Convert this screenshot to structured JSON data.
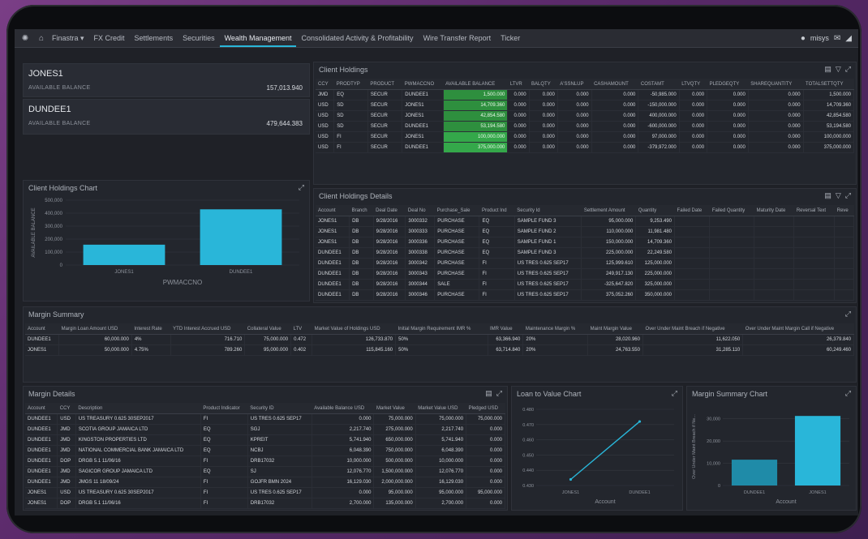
{
  "topbar": {
    "tabs": [
      "Finastra ▾",
      "FX Credit",
      "Settlements",
      "Securities",
      "Wealth Management",
      "Consolidated Activity & Profitability",
      "Wire Transfer Report",
      "Ticker"
    ],
    "active_tab_index": 4,
    "user": "misys"
  },
  "accounts": [
    {
      "name": "JONES1",
      "label": "AVAILABLE BALANCE",
      "value": "157,013.940"
    },
    {
      "name": "DUNDEE1",
      "label": "AVAILABLE BALANCE",
      "value": "479,644.383"
    }
  ],
  "client_holdings": {
    "title": "Client Holdings",
    "columns": [
      "CCY",
      "PRODTYP",
      "PRODUCT",
      "PWMACCNO",
      "AVAILABLE BALANCE",
      "LTVR",
      "BALQTY",
      "A'SSNLUP",
      "CASHAMOUNT",
      "COSTAMT",
      "LTVQTY",
      "PLEDGEQTY",
      "SHAREQUANTITY",
      "TOTALSETTQTY"
    ],
    "rows": [
      [
        "JMD",
        "EQ",
        "SECUR",
        "DUNDEE1",
        "1,500.000",
        "0.000",
        "0.000",
        "0.000",
        "0.000",
        "-50,985.000",
        "0.000",
        "0.000",
        "0.000",
        "1,500.000"
      ],
      [
        "USD",
        "SD",
        "SECUR",
        "JONES1",
        "14,709.360",
        "0.000",
        "0.000",
        "0.000",
        "0.000",
        "-150,000.000",
        "0.000",
        "0.000",
        "0.000",
        "14,709.360"
      ],
      [
        "USD",
        "SD",
        "SECUR",
        "JONES1",
        "42,854.580",
        "0.000",
        "0.000",
        "0.000",
        "0.000",
        "400,000.000",
        "0.000",
        "0.000",
        "0.000",
        "42,854.580"
      ],
      [
        "USD",
        "SD",
        "SECUR",
        "DUNDEE1",
        "53,194.580",
        "0.000",
        "0.000",
        "0.000",
        "0.000",
        "-600,000.000",
        "0.000",
        "0.000",
        "0.000",
        "53,194.580"
      ],
      [
        "USD",
        "FI",
        "SECUR",
        "JONES1",
        "100,000.000",
        "0.000",
        "0.000",
        "0.000",
        "0.000",
        "97,000.000",
        "0.000",
        "0.000",
        "0.000",
        "100,000.000"
      ],
      [
        "USD",
        "FI",
        "SECUR",
        "DUNDEE1",
        "375,000.000",
        "0.000",
        "0.000",
        "0.000",
        "0.000",
        "-379,972.000",
        "0.000",
        "0.000",
        "0.000",
        "375,000.000"
      ]
    ]
  },
  "holdings_chart": {
    "title": "Client Holdings Chart",
    "ylabel": "AVAILABLE BALANCE",
    "xlabel": "PWMACCNO",
    "yticks": [
      "500,000",
      "400,000",
      "300,000",
      "200,000",
      "100,000",
      "0"
    ]
  },
  "holdings_details": {
    "title": "Client Holdings Details",
    "columns": [
      "Account",
      "Branch",
      "Deal Date",
      "Deal No",
      "Purchase_Sale",
      "Product Ind",
      "Security Id",
      "Settlement Amount",
      "Quantity",
      "Failed Date",
      "Failed Quantity",
      "Maturity Date",
      "Reversal Text",
      "Reve"
    ],
    "rows": [
      [
        "JONES1",
        "DB",
        "9/28/2016",
        "3000332",
        "PURCHASE",
        "EQ",
        "SAMPLE FUND 3",
        "95,000.000",
        "9,253.490",
        "",
        "",
        "",
        "",
        ""
      ],
      [
        "JONES1",
        "DB",
        "9/28/2016",
        "3000333",
        "PURCHASE",
        "EQ",
        "SAMPLE FUND 2",
        "110,000.000",
        "11,981.480",
        "",
        "",
        "",
        "",
        ""
      ],
      [
        "JONES1",
        "DB",
        "9/28/2016",
        "3000336",
        "PURCHASE",
        "EQ",
        "SAMPLE FUND 1",
        "150,000.000",
        "14,709.360",
        "",
        "",
        "",
        "",
        ""
      ],
      [
        "DUNDEE1",
        "DB",
        "9/28/2016",
        "3000338",
        "PURCHASE",
        "EQ",
        "SAMPLE FUND 3",
        "225,000.000",
        "22,249.580",
        "",
        "",
        "",
        "",
        ""
      ],
      [
        "DUNDEE1",
        "DB",
        "9/28/2016",
        "3000342",
        "PURCHASE",
        "FI",
        "US TRES 0.625 SEP17",
        "125,999.610",
        "125,000.000",
        "",
        "",
        "",
        "",
        ""
      ],
      [
        "DUNDEE1",
        "DB",
        "9/28/2016",
        "3000343",
        "PURCHASE",
        "FI",
        "US TRES 0.625 SEP17",
        "249,917.130",
        "225,000.000",
        "",
        "",
        "",
        "",
        ""
      ],
      [
        "DUNDEE1",
        "DB",
        "9/28/2016",
        "3000344",
        "SALE",
        "FI",
        "US TRES 0.625 SEP17",
        "-325,647.820",
        "325,000.000",
        "",
        "",
        "",
        "",
        ""
      ],
      [
        "DUNDEE1",
        "DB",
        "9/28/2016",
        "3000346",
        "PURCHASE",
        "FI",
        "US TRES 0.625 SEP17",
        "375,052.260",
        "350,000.000",
        "",
        "",
        "",
        "",
        ""
      ]
    ]
  },
  "margin_summary": {
    "title": "Margin Summary",
    "columns": [
      "Account",
      "Margin Loan Amount USD",
      "Interest Rate",
      "YTD Interest Accrued USD",
      "Collateral Value",
      "LTV",
      "Market Value of Holdings USD",
      "Initial Margin Requirement IMR %",
      "IMR Value",
      "Maintenance Margin %",
      "Maint Margin Value",
      "Over Under Maint Breach if Negative",
      "Over Under Maint Margin Call if Negative"
    ],
    "rows": [
      [
        "DUNDEE1",
        "60,000.000",
        "4%",
        "716.710",
        "75,000.000",
        "0.472",
        "126,733.870",
        "50%",
        "63,366.940",
        "20%",
        "28,020.960",
        "11,622.050",
        "26,379.840"
      ],
      [
        "JONES1",
        "50,000.000",
        "4.75%",
        "789.260",
        "95,000.000",
        "0.402",
        "115,845.160",
        "50%",
        "63,714.840",
        "20%",
        "24,763.550",
        "31,285.110",
        "60,249.460"
      ]
    ]
  },
  "margin_details": {
    "title": "Margin Details",
    "columns": [
      "Account",
      "CCY",
      "Description",
      "Product Indicator",
      "Security ID",
      "Available Balance USD",
      "Market Value",
      "Market Value USD",
      "Pledged USD"
    ],
    "rows": [
      [
        "DUNDEE1",
        "USD",
        "US TREASURY 0.625 30SEP2017",
        "FI",
        "US TRES 0.625 SEP17",
        "0.000",
        "75,000.000",
        "75,000.000",
        "75,000.000"
      ],
      [
        "DUNDEE1",
        "JMD",
        "SCOTIA GROUP JAMAICA LTD",
        "EQ",
        "SGJ",
        "2,217.740",
        "275,000.000",
        "2,217.740",
        "0.000"
      ],
      [
        "DUNDEE1",
        "JMD",
        "KINGSTON PROPERTIES LTD",
        "EQ",
        "KPREIT",
        "5,741.940",
        "650,000.000",
        "5,741.940",
        "0.000"
      ],
      [
        "DUNDEE1",
        "JMD",
        "NATIONAL COMMERCIAL BANK JAMAICA LTD",
        "EQ",
        "NCBJ",
        "6,048.390",
        "750,000.000",
        "6,048.390",
        "0.000"
      ],
      [
        "DUNDEE1",
        "DOP",
        "DRGB 5.1 11/06/16",
        "FI",
        "DRB17032",
        "10,000.000",
        "500,000.000",
        "10,000.000",
        "0.000"
      ],
      [
        "DUNDEE1",
        "JMD",
        "SAGICOR GROUP JAMAICA LTD",
        "EQ",
        "SJ",
        "12,076.770",
        "1,500,000.000",
        "12,076.770",
        "0.000"
      ],
      [
        "DUNDEE1",
        "JMD",
        "JMGS 11 18/09/24",
        "FI",
        "GOJFR BMN 2024",
        "16,129.030",
        "2,000,000.000",
        "16,129.030",
        "0.000"
      ],
      [
        "JONES1",
        "USD",
        "US TREASURY 0.625 30SEP2017",
        "FI",
        "US TRES 0.625 SEP17",
        "0.000",
        "95,000.000",
        "95,000.000",
        "95,000.000"
      ],
      [
        "JONES1",
        "DOP",
        "DRGB 5.1 11/06/16",
        "FI",
        "DRB17032",
        "2,700.000",
        "135,000.000",
        "2,700.000",
        "0.000"
      ]
    ]
  },
  "ltv_chart": {
    "title": "Loan to Value Chart",
    "xlabel": "Account",
    "yticks": [
      "0.480",
      "0.470",
      "0.460",
      "0.450",
      "0.440",
      "0.430"
    ]
  },
  "margin_summary_chart": {
    "title": "Margin Summary Chart",
    "ylabel": "Over Under Maint Breach if Ne...",
    "xlabel": "Account",
    "yticks": [
      "30,000",
      "20,000",
      "10,000",
      "0"
    ]
  },
  "chart_data": [
    {
      "type": "bar",
      "title": "Client Holdings Chart",
      "categories": [
        "JONES1",
        "DUNDEE1"
      ],
      "values": [
        157013.94,
        429644.38
      ],
      "xlabel": "PWMACCNO",
      "ylabel": "AVAILABLE BALANCE",
      "ylim": [
        0,
        500000
      ]
    },
    {
      "type": "line",
      "title": "Loan to Value Chart",
      "categories": [
        "JONES1",
        "DUNDEE1"
      ],
      "values": [
        0.434,
        0.472
      ],
      "xlabel": "Account",
      "ylim": [
        0.43,
        0.48
      ]
    },
    {
      "type": "bar",
      "title": "Margin Summary Chart",
      "categories": [
        "DUNDEE1",
        "JONES1"
      ],
      "values": [
        11622.05,
        31285.11
      ],
      "xlabel": "Account",
      "ylabel": "Over Under Maint Breach if Ne...",
      "ylim": [
        0,
        35000
      ]
    }
  ],
  "colors": {
    "accent": "#29b6d9",
    "positive": "#34a84a",
    "background": "#1f2127"
  }
}
